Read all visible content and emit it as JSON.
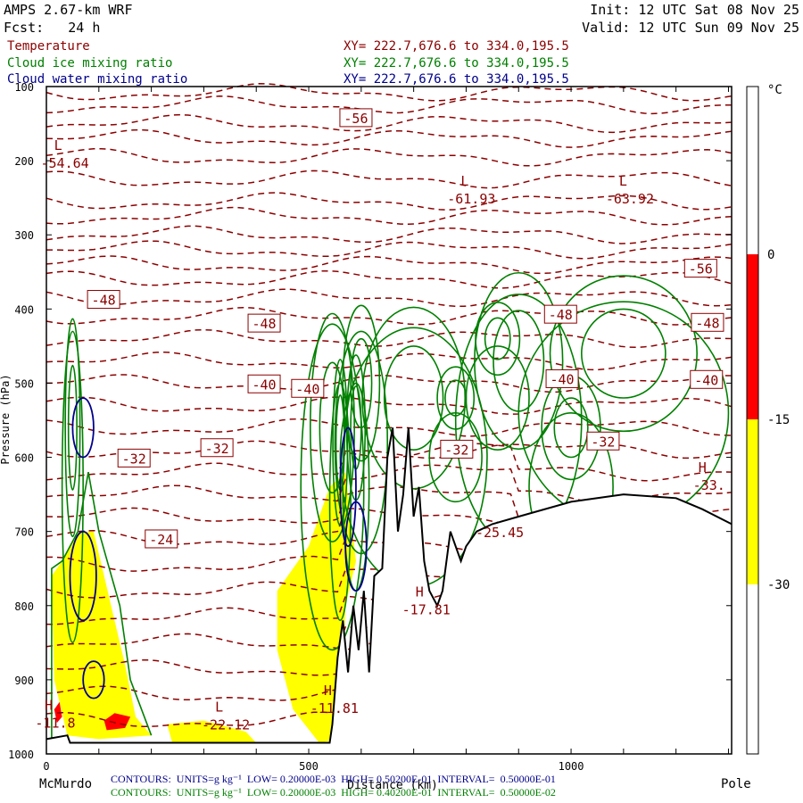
{
  "header": {
    "model": "AMPS 2.67-km WRF",
    "fcst": "Fcst:   24 h",
    "init": "Init: 12 UTC Sat 08 Nov 25",
    "valid": "Valid: 12 UTC Sun 09 Nov 25"
  },
  "legend": [
    {
      "name": "Temperature",
      "xy": "XY= 222.7,676.6 to 334.0,195.5",
      "color": "#8b0000"
    },
    {
      "name": "Cloud ice mixing ratio",
      "xy": "XY= 222.7,676.6 to 334.0,195.5",
      "color": "#008000"
    },
    {
      "name": "Cloud water mixing ratio",
      "xy": "XY= 222.7,676.6 to 334.0,195.5",
      "color": "#00008b"
    }
  ],
  "footer": {
    "left_station": "McMurdo",
    "right_station": "Pole",
    "contours_blue": "CONTOURS:  UNITS=g kg⁻¹  LOW= 0.20000E-03  HIGH= 0.50200E-01  INTERVAL=  0.50000E-01",
    "contours_green": "CONTOURS:  UNITS=g kg⁻¹  LOW= 0.20000E-03  HIGH= 0.40200E-01  INTERVAL=  0.50000E-02"
  },
  "colorbar": {
    "unit": "°C",
    "labels": [
      "0",
      "-15",
      "-30"
    ],
    "bands": [
      {
        "from": -30,
        "to": -15,
        "color": "#ffff00"
      },
      {
        "from": -15,
        "to": 0,
        "color": "#ff0000"
      }
    ]
  },
  "chart_data": {
    "type": "cross-section contour",
    "xlabel": "Distance (km)",
    "ylabel": "Pressure (hPa)",
    "xlim": [
      0,
      1306
    ],
    "ylim": [
      1000,
      100
    ],
    "xticks": [
      "0",
      "500",
      "1000"
    ],
    "yticks": [
      "100",
      "200",
      "300",
      "400",
      "500",
      "600",
      "700",
      "800",
      "900",
      "1000"
    ],
    "isotherm_labels": [
      {
        "km": 590,
        "p": 142,
        "text": "-56"
      },
      {
        "km": 1247,
        "p": 345,
        "text": "-56"
      },
      {
        "km": 109,
        "p": 387,
        "text": "-48"
      },
      {
        "km": 415,
        "p": 419,
        "text": "-48"
      },
      {
        "km": 980,
        "p": 407,
        "text": "-48"
      },
      {
        "km": 1260,
        "p": 418,
        "text": "-48"
      },
      {
        "km": 415,
        "p": 501,
        "text": "-40"
      },
      {
        "km": 498,
        "p": 507,
        "text": "-40"
      },
      {
        "km": 983,
        "p": 494,
        "text": "-40"
      },
      {
        "km": 1258,
        "p": 495,
        "text": "-40"
      },
      {
        "km": 167,
        "p": 601,
        "text": "-32"
      },
      {
        "km": 325,
        "p": 587,
        "text": "-32"
      },
      {
        "km": 782,
        "p": 589,
        "text": "-32"
      },
      {
        "km": 1061,
        "p": 578,
        "text": "-32"
      },
      {
        "km": 219,
        "p": 710,
        "text": "-24"
      }
    ],
    "extrema": [
      {
        "km": 35,
        "p": 200,
        "type": "L",
        "value": "-54.64"
      },
      {
        "km": 810,
        "p": 248,
        "type": "L",
        "value": "-61.93"
      },
      {
        "km": 1112,
        "p": 248,
        "type": "L",
        "value": "-63.92"
      },
      {
        "km": 1263,
        "p": 634,
        "type": "H",
        "value": "-33."
      },
      {
        "km": 724,
        "p": 802,
        "type": "H",
        "value": "-17.81"
      },
      {
        "km": 549,
        "p": 935,
        "type": "H",
        "value": "-11.81"
      },
      {
        "km": 342,
        "p": 957,
        "type": "L",
        "value": "-22.12"
      },
      {
        "km": 864,
        "p": 698,
        "type": "",
        "value": "-25.45"
      },
      {
        "km": 17,
        "p": 955,
        "type": "H",
        "value": "-11.8"
      }
    ],
    "terrain": [
      [
        0,
        980
      ],
      [
        40,
        975
      ],
      [
        45,
        985
      ],
      [
        100,
        985
      ],
      [
        540,
        985
      ],
      [
        545,
        960
      ],
      [
        555,
        870
      ],
      [
        565,
        820
      ],
      [
        575,
        890
      ],
      [
        585,
        800
      ],
      [
        595,
        860
      ],
      [
        605,
        780
      ],
      [
        615,
        890
      ],
      [
        625,
        760
      ],
      [
        640,
        750
      ],
      [
        650,
        600
      ],
      [
        660,
        560
      ],
      [
        670,
        700
      ],
      [
        680,
        650
      ],
      [
        690,
        560
      ],
      [
        700,
        680
      ],
      [
        710,
        640
      ],
      [
        720,
        740
      ],
      [
        730,
        780
      ],
      [
        745,
        800
      ],
      [
        755,
        780
      ],
      [
        770,
        700
      ],
      [
        790,
        740
      ],
      [
        800,
        720
      ],
      [
        820,
        700
      ],
      [
        850,
        690
      ],
      [
        900,
        680
      ],
      [
        1000,
        660
      ],
      [
        1100,
        650
      ],
      [
        1200,
        655
      ],
      [
        1250,
        670
      ],
      [
        1306,
        690
      ]
    ],
    "isotherm_levels_hpa": [
      108,
      125,
      150,
      170,
      195,
      225,
      255,
      275,
      300,
      320,
      340,
      360,
      385,
      410,
      440,
      470,
      500,
      530,
      560,
      590,
      620,
      650,
      680,
      710,
      745,
      780,
      815,
      850,
      885,
      920,
      955
    ]
  }
}
